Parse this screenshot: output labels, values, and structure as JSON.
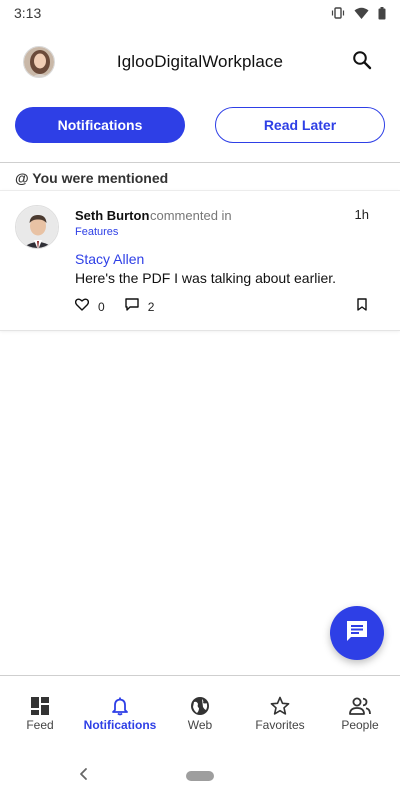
{
  "status_bar": {
    "time": "3:13"
  },
  "header": {
    "title": "IglooDigitalWorkplace"
  },
  "tabs": [
    {
      "label": "Notifications",
      "active": true
    },
    {
      "label": "Read Later",
      "active": false
    }
  ],
  "section": {
    "label": "@ You were mentioned"
  },
  "notification": {
    "author": "Seth Burton",
    "action": "commented in",
    "place": "Features",
    "time": "1h",
    "mention": "Stacy Allen",
    "body": "Here's the PDF I was talking about earlier.",
    "likes": "0",
    "comments": "2"
  },
  "bottom_nav": [
    {
      "label": "Feed",
      "icon": "feed-icon",
      "active": false
    },
    {
      "label": "Notifications",
      "icon": "bell-icon",
      "active": true
    },
    {
      "label": "Web",
      "icon": "globe-icon",
      "active": false
    },
    {
      "label": "Favorites",
      "icon": "star-icon",
      "active": false
    },
    {
      "label": "People",
      "icon": "people-icon",
      "active": false
    }
  ],
  "colors": {
    "accent": "#2e3fe6",
    "text": "#111111",
    "muted": "#777777"
  }
}
